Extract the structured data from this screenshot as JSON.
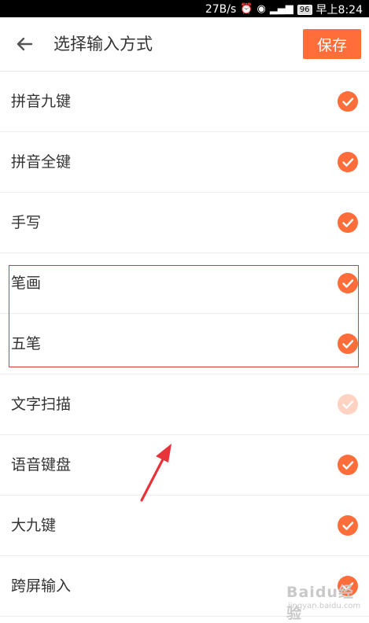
{
  "status_bar": {
    "speed": "27B/s",
    "battery": "96",
    "time": "早上8:24",
    "icons": [
      "alarm-icon",
      "eye-icon",
      "4g-signal-icon",
      "signal-bars-icon",
      "battery-icon"
    ]
  },
  "header": {
    "title": "选择输入方式",
    "save_label": "保存",
    "back_icon": "arrow-left-icon"
  },
  "colors": {
    "accent": "#ff6e3a",
    "highlight_border": "#e0363a",
    "annotation_arrow": "#e8333a"
  },
  "input_methods": [
    {
      "label": "拼音九键",
      "checked": true,
      "enabled": true
    },
    {
      "label": "拼音全键",
      "checked": true,
      "enabled": true
    },
    {
      "label": "手写",
      "checked": true,
      "enabled": true
    },
    {
      "label": "笔画",
      "checked": true,
      "enabled": true
    },
    {
      "label": "五笔",
      "checked": true,
      "enabled": true
    },
    {
      "label": "文字扫描",
      "checked": true,
      "enabled": false
    },
    {
      "label": "语音键盘",
      "checked": true,
      "enabled": true
    },
    {
      "label": "大九键",
      "checked": true,
      "enabled": true
    },
    {
      "label": "跨屏输入",
      "checked": true,
      "enabled": true
    }
  ],
  "watermark": {
    "brand": "Baidu经验",
    "url": "jingyan.baidu.com"
  }
}
